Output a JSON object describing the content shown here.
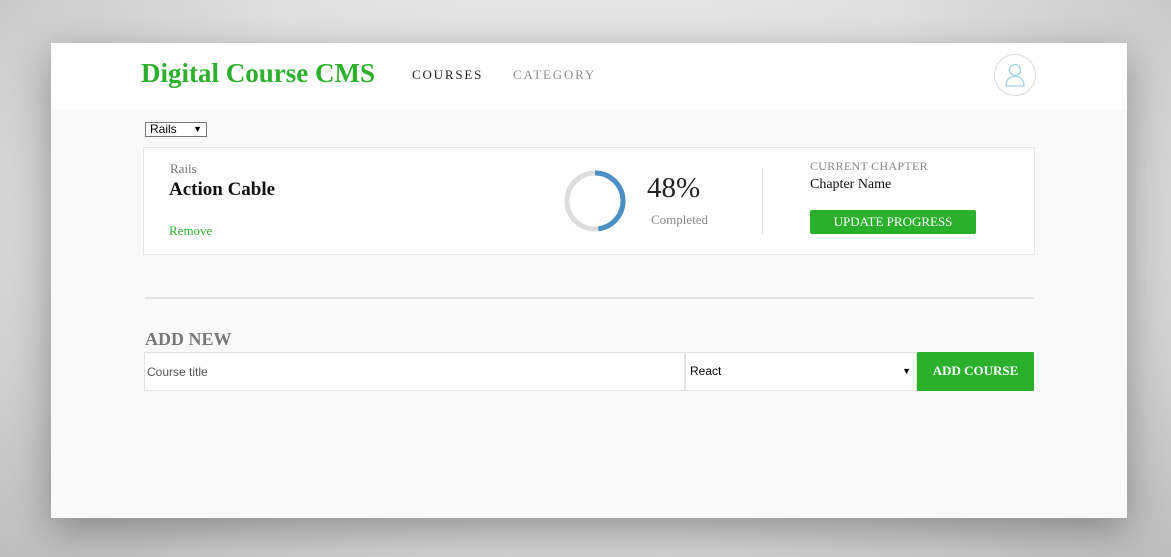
{
  "brand": {
    "title": "Digital Course CMS",
    "color": "#2db02d"
  },
  "nav": {
    "courses_label": "COURSES",
    "category_label": "CATEGORY"
  },
  "filter": {
    "selected": "Rails"
  },
  "course_card": {
    "category": "Rails",
    "title": "Action Cable",
    "remove_label": "Remove",
    "progress": {
      "percent_text": "48%",
      "percent": 48,
      "label": "Completed",
      "ring_color": "#4a90c4",
      "track_color": "#dddddd"
    },
    "chapter": {
      "heading": "CURRENT CHAPTER",
      "name": "Chapter Name",
      "update_label": "UPDATE PROGRESS"
    }
  },
  "add_new": {
    "heading": "ADD NEW",
    "title_placeholder": "Course title",
    "category_selected": "React",
    "add_label": "ADD COURSE",
    "accent": "#2bb02b"
  },
  "icons": {
    "avatar": "user-icon",
    "dropdown": "chevron-down-icon"
  }
}
